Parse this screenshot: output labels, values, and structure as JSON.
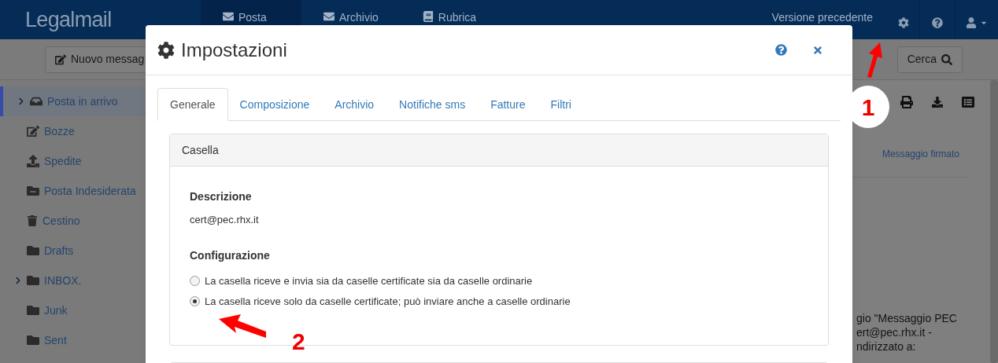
{
  "navbar": {
    "logo": "Legalmail",
    "tabs": [
      {
        "label": "Posta",
        "selected": true
      },
      {
        "label": "Archivio",
        "selected": false
      },
      {
        "label": "Rubrica",
        "selected": false
      }
    ],
    "previous_version": "Versione precedente"
  },
  "toolbar": {
    "new_message": "Nuovo messag",
    "search": "Cerca"
  },
  "sidebar": {
    "items": [
      {
        "label": "Posta in arrivo",
        "kind": "inbox",
        "selected": true,
        "expandable": true
      },
      {
        "label": "Bozze",
        "kind": "drafts",
        "selected": false,
        "expandable": false
      },
      {
        "label": "Spedite",
        "kind": "sent",
        "selected": false,
        "expandable": false
      },
      {
        "label": "Posta Indesiderata",
        "kind": "spam",
        "selected": false,
        "expandable": false
      },
      {
        "label": "Cestino",
        "kind": "trash",
        "selected": false,
        "expandable": false
      },
      {
        "label": "Drafts",
        "kind": "folder",
        "selected": false,
        "expandable": false
      },
      {
        "label": "INBOX.",
        "kind": "folder",
        "selected": false,
        "expandable": true
      },
      {
        "label": "Junk",
        "kind": "folder",
        "selected": false,
        "expandable": false
      },
      {
        "label": "Sent",
        "kind": "folder",
        "selected": false,
        "expandable": false
      }
    ]
  },
  "message": {
    "signed": "Messaggio firmato",
    "body_lines": [
      "gio \"Messaggio PEC",
      "ert@pec.rhx.it -",
      "ndirizzato a:"
    ]
  },
  "dialog": {
    "title": "Impostazioni",
    "tabs": [
      {
        "label": "Generale",
        "selected": true
      },
      {
        "label": "Composizione",
        "selected": false
      },
      {
        "label": "Archivio",
        "selected": false
      },
      {
        "label": "Notifiche sms",
        "selected": false
      },
      {
        "label": "Fatture",
        "selected": false
      },
      {
        "label": "Filtri",
        "selected": false
      }
    ],
    "panel": {
      "heading": "Casella",
      "description_label": "Descrizione",
      "description_value": "cert@pec.rhx.it",
      "config_label": "Configurazione",
      "options": [
        {
          "label": "La casella riceve e invia sia da caselle certificate sia da caselle ordinarie",
          "selected": false
        },
        {
          "label": "La casella riceve solo da caselle certificate; può inviare anche a caselle ordinarie",
          "selected": true
        }
      ]
    }
  },
  "annotations": [
    {
      "label": "1"
    },
    {
      "label": "2"
    }
  ]
}
